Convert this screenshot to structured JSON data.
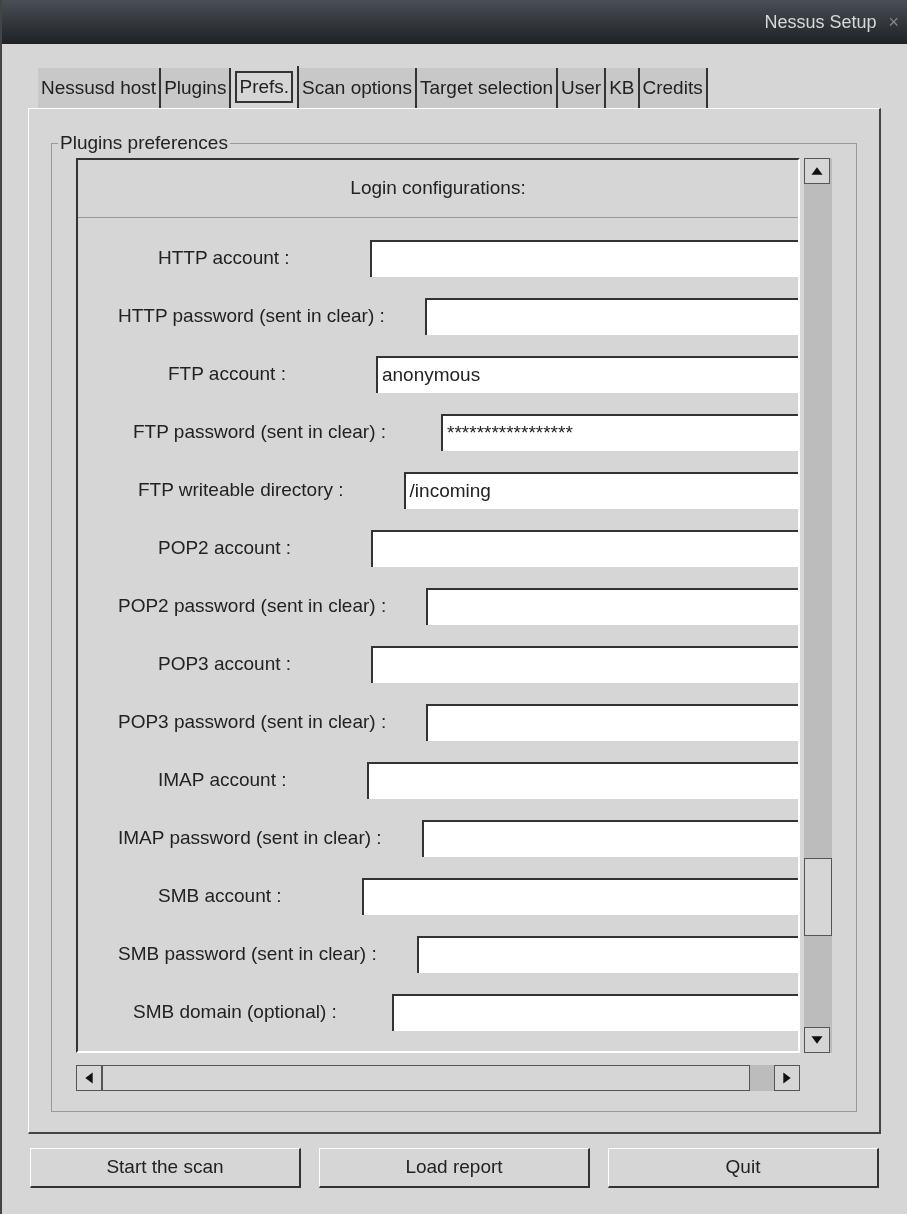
{
  "window": {
    "title": "Nessus Setup",
    "close": "×"
  },
  "tabs": [
    {
      "label": "Nessusd host",
      "selected": false
    },
    {
      "label": "Plugins",
      "selected": false
    },
    {
      "label": "Prefs.",
      "selected": true
    },
    {
      "label": "Scan options",
      "selected": false
    },
    {
      "label": "Target selection",
      "selected": false
    },
    {
      "label": "User",
      "selected": false
    },
    {
      "label": "KB",
      "selected": false
    },
    {
      "label": "Credits",
      "selected": false
    }
  ],
  "group_title": "Plugins preferences",
  "section_title": "Login configurations:",
  "fields": [
    {
      "label": "HTTP account :"
    },
    {
      "label": "HTTP password (sent in clear) :"
    },
    {
      "label": "FTP account :",
      "value": "anonymous"
    },
    {
      "label": "FTP password (sent in clear) :",
      "value": "*****************"
    },
    {
      "label": "FTP writeable directory :",
      "value": "/incoming"
    },
    {
      "label": "POP2 account :"
    },
    {
      "label": "POP2 password (sent in clear) :"
    },
    {
      "label": "POP3 account :"
    },
    {
      "label": "POP3 password (sent in clear) :"
    },
    {
      "label": "IMAP account :"
    },
    {
      "label": "IMAP password (sent in clear) :"
    },
    {
      "label": "SMB account :"
    },
    {
      "label": "SMB password (sent in clear) :"
    },
    {
      "label": "SMB domain (optional) :"
    }
  ],
  "buttons": [
    "Start the scan",
    "Load report",
    "Quit"
  ]
}
